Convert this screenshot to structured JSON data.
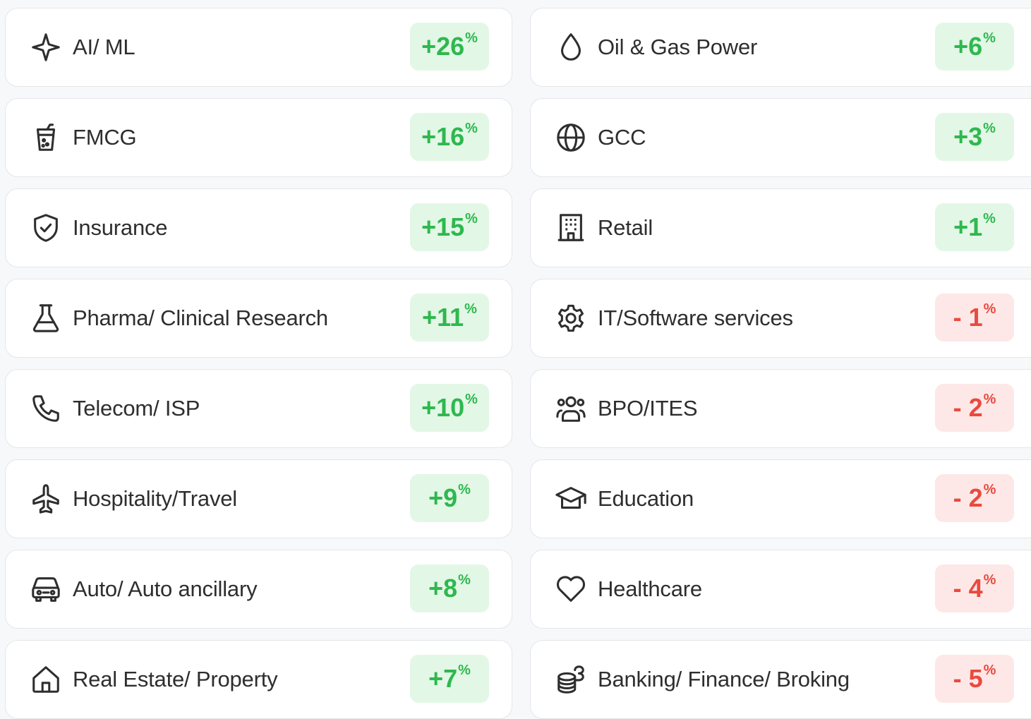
{
  "colors": {
    "up_text": "#2eb84f",
    "up_bg": "#e3f7e6",
    "down_text": "#ea4a3f",
    "down_bg": "#fde8e7"
  },
  "percent_symbol": "%",
  "left": [
    {
      "label": "AI/ ML",
      "value": "+26",
      "icon": "sparkle-icon",
      "trend": "up"
    },
    {
      "label": "FMCG",
      "value": "+16",
      "icon": "drink-cup-icon",
      "trend": "up"
    },
    {
      "label": "Insurance",
      "value": "+15",
      "icon": "shield-check-icon",
      "trend": "up"
    },
    {
      "label": "Pharma/ Clinical Research",
      "value": "+11",
      "icon": "flask-icon",
      "trend": "up"
    },
    {
      "label": "Telecom/ ISP",
      "value": "+10",
      "icon": "phone-icon",
      "trend": "up"
    },
    {
      "label": "Hospitality/Travel",
      "value": "+9",
      "icon": "airplane-icon",
      "trend": "up"
    },
    {
      "label": "Auto/ Auto ancillary",
      "value": "+8",
      "icon": "car-icon",
      "trend": "up"
    },
    {
      "label": "Real Estate/ Property",
      "value": "+7",
      "icon": "house-icon",
      "trend": "up"
    }
  ],
  "right": [
    {
      "label": "Oil & Gas Power",
      "value": "+6",
      "icon": "droplet-icon",
      "trend": "up"
    },
    {
      "label": "GCC",
      "value": "+3",
      "icon": "globe-icon",
      "trend": "up"
    },
    {
      "label": "Retail",
      "value": "+1",
      "icon": "building-icon",
      "trend": "up"
    },
    {
      "label": "IT/Software services",
      "value": "- 1",
      "icon": "gear-icon",
      "trend": "down"
    },
    {
      "label": "BPO/ITES",
      "value": "- 2",
      "icon": "users-icon",
      "trend": "down"
    },
    {
      "label": "Education",
      "value": "- 2",
      "icon": "graduation-cap-icon",
      "trend": "down"
    },
    {
      "label": "Healthcare",
      "value": "- 4",
      "icon": "heart-icon",
      "trend": "down"
    },
    {
      "label": "Banking/ Finance/ Broking",
      "value": "- 5",
      "icon": "coins-icon",
      "trend": "down"
    }
  ]
}
